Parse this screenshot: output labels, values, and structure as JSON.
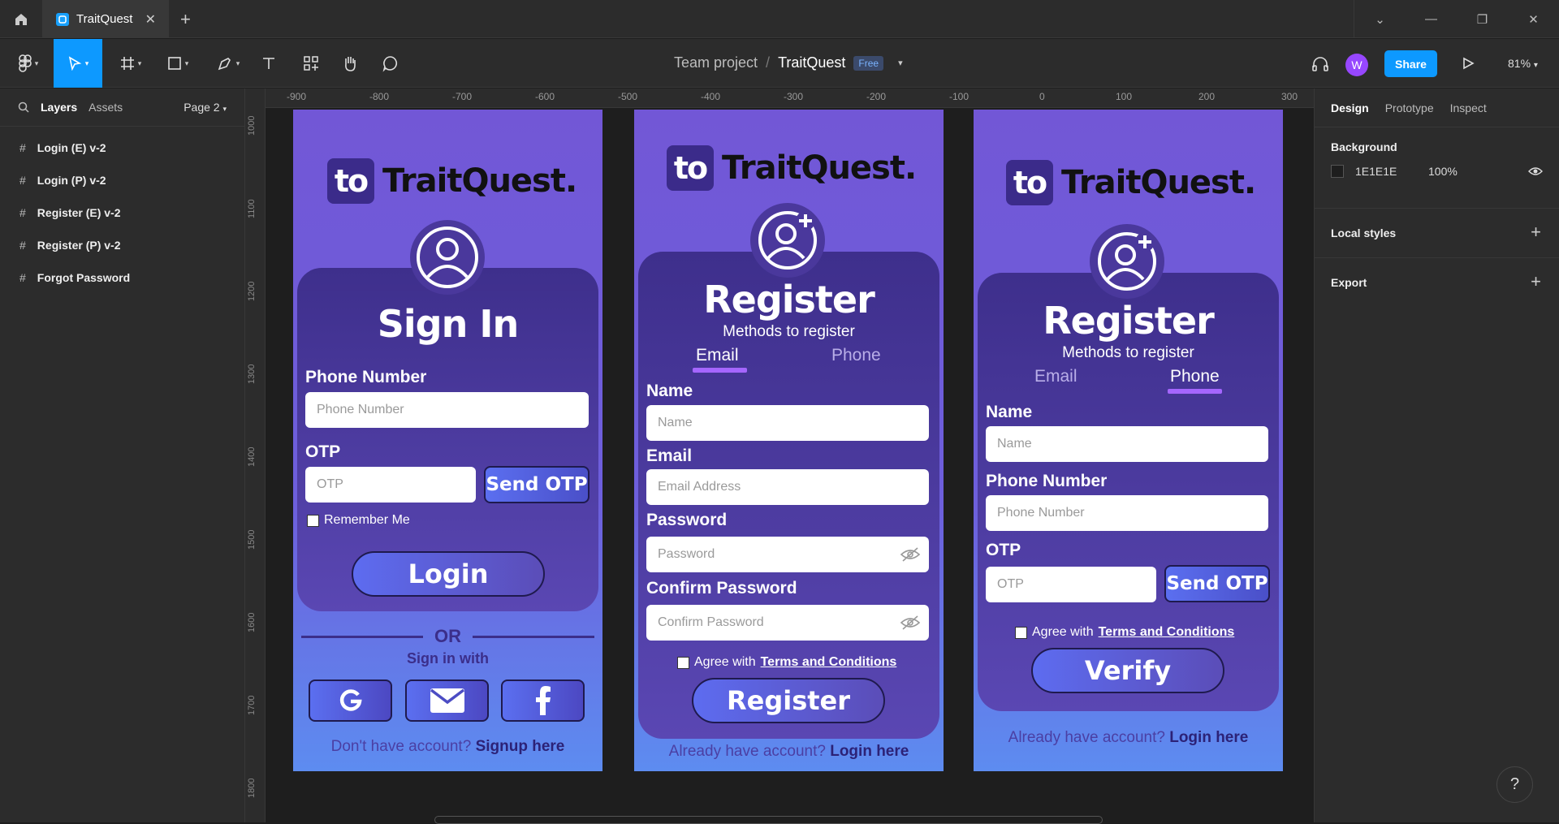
{
  "titlebar": {
    "tab_title": "TraitQuest"
  },
  "toolbar": {
    "team": "Team project",
    "separator": "/",
    "file": "TraitQuest",
    "plan_badge": "Free",
    "avatar_initial": "W",
    "share_label": "Share",
    "zoom": "81%"
  },
  "left_panel": {
    "tab_layers": "Layers",
    "tab_assets": "Assets",
    "page": "Page 2",
    "layers": [
      {
        "name": "Login (E) v-2"
      },
      {
        "name": "Login (P) v-2"
      },
      {
        "name": "Register (E) v-2"
      },
      {
        "name": "Register (P) v-2"
      },
      {
        "name": "Forgot Password"
      }
    ]
  },
  "rulers": {
    "top": [
      "-900",
      "-800",
      "-700",
      "-600",
      "-500",
      "-400",
      "-300",
      "-200",
      "-100",
      "0",
      "100",
      "200",
      "300"
    ],
    "left": [
      "1000",
      "1100",
      "1200",
      "1300",
      "1400",
      "1500",
      "1600",
      "1700",
      "1800"
    ]
  },
  "right_panel": {
    "tab_design": "Design",
    "tab_prototype": "Prototype",
    "tab_inspect": "Inspect",
    "background_label": "Background",
    "bg_color": "1E1E1E",
    "bg_opacity": "100%",
    "local_styles": "Local styles",
    "export": "Export"
  },
  "help": "?",
  "brand": {
    "logo_mark": "to",
    "logo_text": "TraitQuest."
  },
  "signin": {
    "title": "Sign In",
    "phone_label": "Phone Number",
    "phone_placeholder": "Phone Number",
    "otp_label": "OTP",
    "otp_placeholder": "OTP",
    "send_otp": "Send OTP",
    "remember": "Remember Me",
    "login_btn": "Login",
    "or": "OR",
    "sign_in_with": "Sign in with",
    "footer_text": "Don't have account?",
    "footer_link": "Signup here"
  },
  "register_email": {
    "title": "Register",
    "methods": "Methods to register",
    "tab_email": "Email",
    "tab_phone": "Phone",
    "name_label": "Name",
    "name_placeholder": "Name",
    "email_label": "Email",
    "email_placeholder": "Email Address",
    "password_label": "Password",
    "password_placeholder": "Password",
    "confirm_label": "Confirm Password",
    "confirm_placeholder": "Confirm Password",
    "agree_text": "Agree with",
    "terms": "Terms and Conditions",
    "register_btn": "Register",
    "footer_text": "Already have account?",
    "footer_link": "Login here"
  },
  "register_phone": {
    "title": "Register",
    "methods": "Methods to register",
    "tab_email": "Email",
    "tab_phone": "Phone",
    "name_label": "Name",
    "name_placeholder": "Name",
    "phone_label": "Phone Number",
    "phone_placeholder": "Phone Number",
    "otp_label": "OTP",
    "otp_placeholder": "OTP",
    "send_otp": "Send OTP",
    "agree_text": "Agree with",
    "terms": "Terms and Conditions",
    "verify_btn": "Verify",
    "footer_text": "Already have account?",
    "footer_link": "Login here"
  },
  "colors": {
    "accent": "#0d99ff",
    "brand_purple": "#7257d6",
    "card": "#3e2f8c",
    "underline": "#a566ff"
  }
}
